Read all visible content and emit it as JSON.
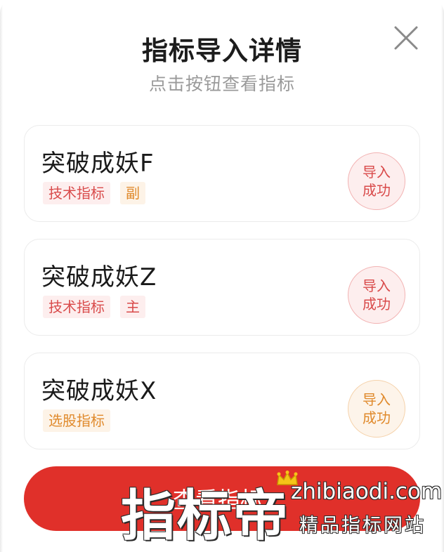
{
  "modal": {
    "title": "指标导入详情",
    "subtitle": "点击按钮查看指标",
    "close_icon": "close-icon"
  },
  "indicators": [
    {
      "name": "突破成妖F",
      "tags": [
        {
          "label": "技术指标",
          "color": "red"
        },
        {
          "label": "副",
          "color": "orange"
        }
      ],
      "status": "导入成功",
      "status_color": "red"
    },
    {
      "name": "突破成妖Z",
      "tags": [
        {
          "label": "技术指标",
          "color": "red"
        },
        {
          "label": "主",
          "color": "red"
        }
      ],
      "status": "导入成功",
      "status_color": "red"
    },
    {
      "name": "突破成妖X",
      "tags": [
        {
          "label": "选股指标",
          "color": "orange"
        }
      ],
      "status": "导入成功",
      "status_color": "orange"
    }
  ],
  "primary_button": {
    "label": "查看指标",
    "color": "#e0302a"
  },
  "watermark": {
    "brand": "指标帝",
    "domain": "zhibiaodi.com",
    "tagline": "精品指标网站"
  },
  "colors": {
    "accent_red": "#d94b4b",
    "accent_orange": "#e08a2c"
  }
}
